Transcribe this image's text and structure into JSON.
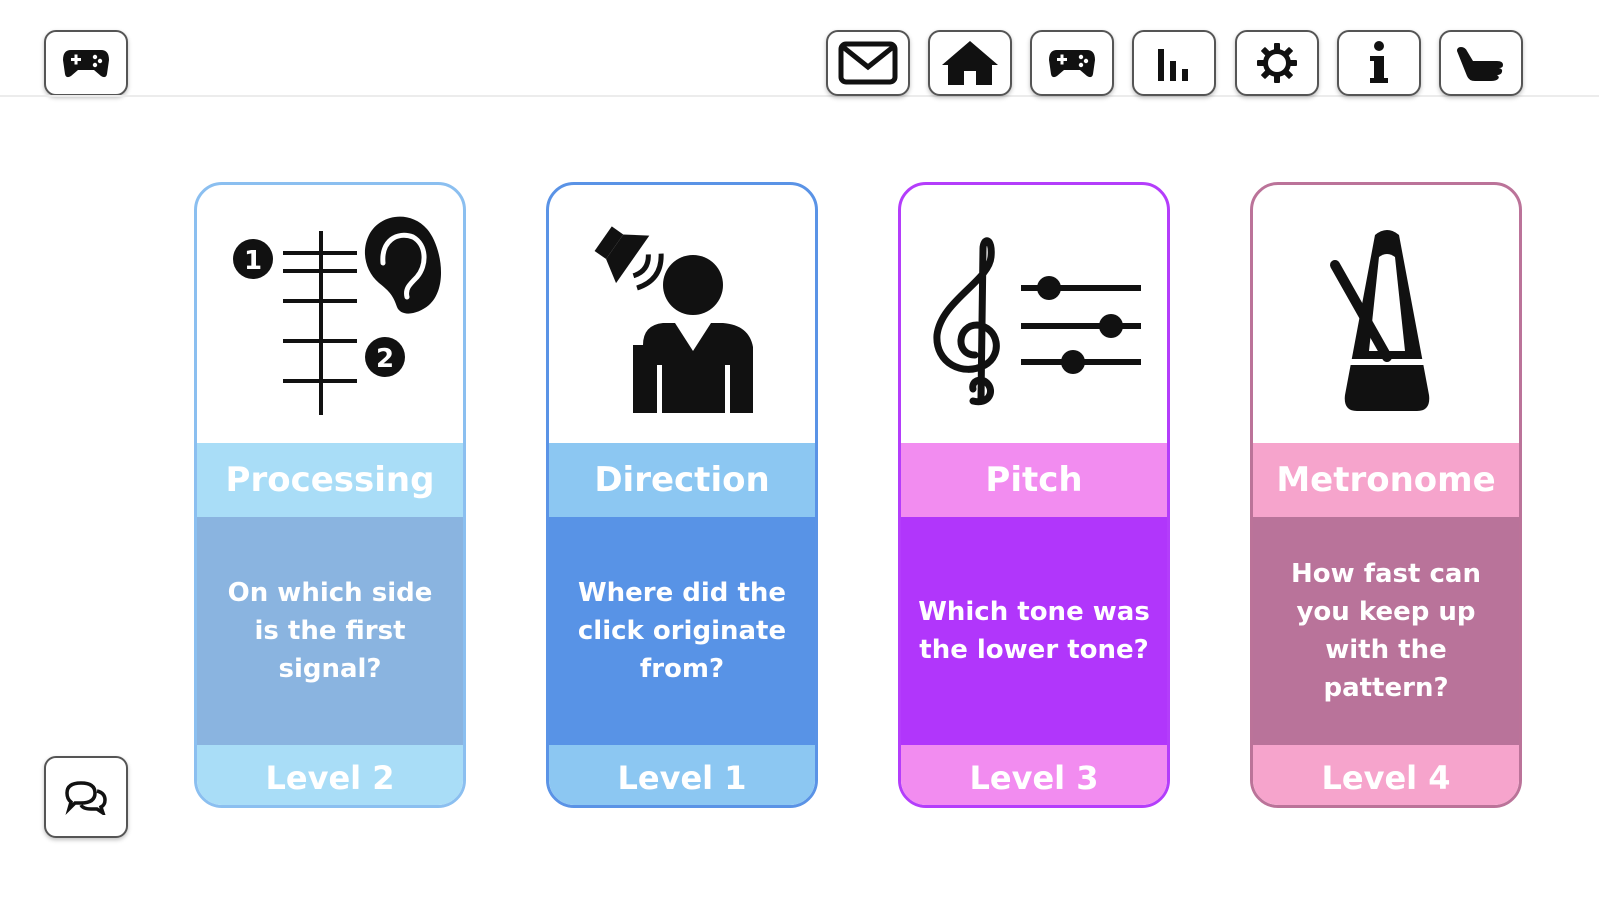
{
  "toolbar": {
    "left_icon": "gamepad-icon",
    "icons": [
      "mail-icon",
      "home-icon",
      "gamepad-icon",
      "bar-chart-icon",
      "gear-icon",
      "info-icon",
      "pointing-hand-icon"
    ]
  },
  "chat_icon": "chat-bubbles-icon",
  "cards": [
    {
      "title": "Processing",
      "description": "On which side is the first signal?",
      "level": "Level 2",
      "icon": "sequence-ear-icon",
      "colors": {
        "border": "#8bbff0",
        "title_bg": "#a9ddf7",
        "desc_bg": "#8ab4e0",
        "level_bg": "#a9ddf7"
      }
    },
    {
      "title": "Direction",
      "description": "Where did the click originate from?",
      "level": "Level 1",
      "icon": "speaker-person-icon",
      "colors": {
        "border": "#5a93e6",
        "title_bg": "#8cc7f2",
        "desc_bg": "#5893e6",
        "level_bg": "#8cc7f2"
      }
    },
    {
      "title": "Pitch",
      "description": "Which tone was the lower tone?",
      "level": "Level 3",
      "icon": "treble-clef-sliders-icon",
      "colors": {
        "border": "#b43dfb",
        "title_bg": "#f28cf0",
        "desc_bg": "#b136fb",
        "level_bg": "#f28cf0"
      }
    },
    {
      "title": "Metronome",
      "description": "How fast can you keep up with the pattern?",
      "level": "Level 4",
      "icon": "metronome-icon",
      "colors": {
        "border": "#bb7399",
        "title_bg": "#f6a4cc",
        "desc_bg": "#b9739a",
        "level_bg": "#f6a4cc"
      }
    }
  ]
}
